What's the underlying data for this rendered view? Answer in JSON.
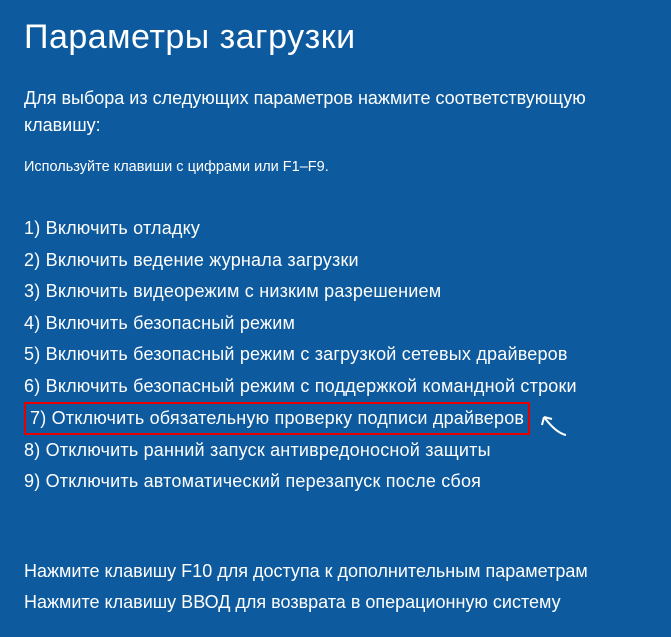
{
  "title": "Параметры загрузки",
  "instruction": "Для выбора из следующих параметров нажмите соответствующую клавишу:",
  "hint": "Используйте клавиши с цифрами или F1–F9.",
  "options": [
    {
      "num": "1)",
      "label": "Включить отладку",
      "highlighted": false
    },
    {
      "num": "2)",
      "label": "Включить ведение журнала загрузки",
      "highlighted": false
    },
    {
      "num": "3)",
      "label": "Включить видеорежим с низким разрешением",
      "highlighted": false
    },
    {
      "num": "4)",
      "label": "Включить безопасный режим",
      "highlighted": false
    },
    {
      "num": "5)",
      "label": "Включить безопасный режим с загрузкой сетевых драйверов",
      "highlighted": false
    },
    {
      "num": "6)",
      "label": "Включить безопасный режим с поддержкой командной строки",
      "highlighted": false
    },
    {
      "num": "7)",
      "label": "Отключить обязательную проверку подписи драйверов",
      "highlighted": true
    },
    {
      "num": "8)",
      "label": "Отключить ранний запуск антивредоносной защиты",
      "highlighted": false
    },
    {
      "num": "9)",
      "label": "Отключить автоматический перезапуск после сбоя",
      "highlighted": false
    }
  ],
  "footer": {
    "line1": "Нажмите клавишу F10 для доступа к дополнительным параметрам",
    "line2": "Нажмите клавишу ВВОД для возврата в операционную систему"
  }
}
